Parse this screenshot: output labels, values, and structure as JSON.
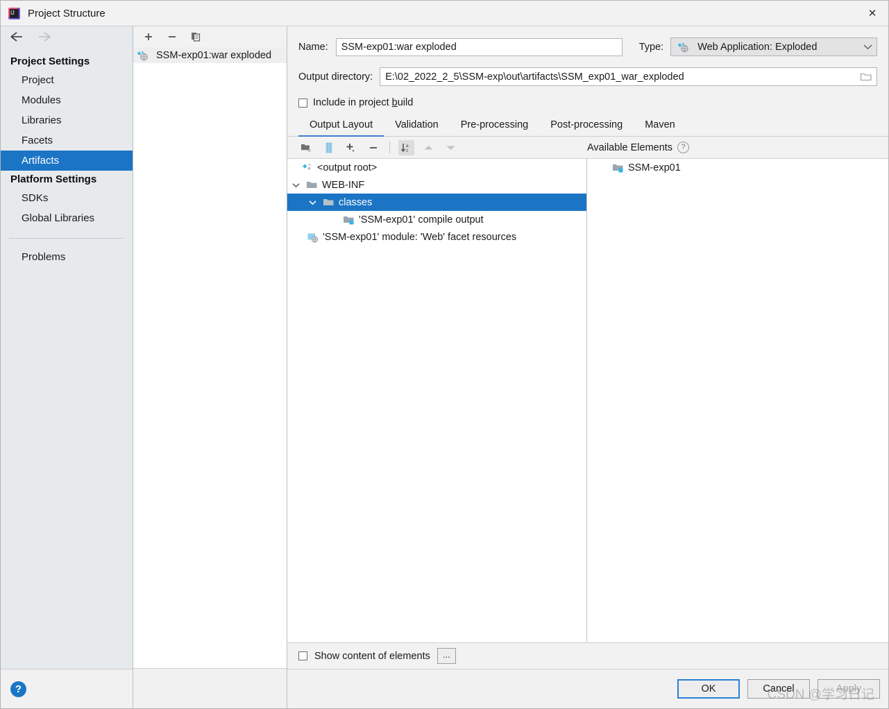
{
  "window": {
    "title": "Project Structure",
    "app_icon": "intellij-idea-icon",
    "close_label": "✕"
  },
  "sidebar": {
    "back_icon": "arrow-left-icon",
    "forward_icon": "arrow-right-icon",
    "groups": [
      {
        "title": "Project Settings",
        "items": [
          {
            "label": "Project",
            "selected": false
          },
          {
            "label": "Modules",
            "selected": false
          },
          {
            "label": "Libraries",
            "selected": false
          },
          {
            "label": "Facets",
            "selected": false
          },
          {
            "label": "Artifacts",
            "selected": true
          }
        ]
      },
      {
        "title": "Platform Settings",
        "items": [
          {
            "label": "SDKs",
            "selected": false
          },
          {
            "label": "Global Libraries",
            "selected": false
          }
        ]
      }
    ],
    "problems": {
      "label": "Problems"
    },
    "help_icon": "help-question-icon",
    "help_label": "?"
  },
  "artifacts_panel": {
    "toolbar": [
      {
        "name": "add-artifact-button",
        "glyph": "+"
      },
      {
        "name": "remove-artifact-button",
        "glyph": "−"
      },
      {
        "name": "copy-artifact-button",
        "glyph": "copy-icon"
      }
    ],
    "items": [
      {
        "label": "SSM-exp01:war exploded",
        "icon": "web-exploded-artifact-icon",
        "selected": true
      }
    ]
  },
  "form": {
    "name_label": "Name:",
    "name_value": "SSM-exp01:war exploded",
    "name_placeholder": "",
    "type_label": "Type:",
    "type_value": "Web Application: Exploded",
    "type_icon": "web-exploded-artifact-icon",
    "output_dir_label": "Output directory:",
    "output_dir_value": "E:\\02_2022_2_5\\SSM-exp\\out\\artifacts\\SSM_exp01_war_exploded",
    "output_dir_placeholder": "",
    "browse_icon": "folder-browse-icon",
    "include_build_label_pre": "Include in project ",
    "include_build_label_accel": "b",
    "include_build_label_post": "uild",
    "include_build_checked": false
  },
  "tabs": [
    {
      "label": "Output Layout",
      "active": true
    },
    {
      "label": "Validation",
      "active": false
    },
    {
      "label": "Pre-processing",
      "active": false
    },
    {
      "label": "Post-processing",
      "active": false
    },
    {
      "label": "Maven",
      "active": false
    }
  ],
  "layout_toolbar": [
    {
      "name": "create-directory-button",
      "icon": "folder-add-icon",
      "state": "enabled"
    },
    {
      "name": "create-archive-button",
      "icon": "archive-jar-icon",
      "state": "enabled"
    },
    {
      "name": "add-copy-of-button",
      "icon": "plus-dropdown-icon",
      "state": "enabled"
    },
    {
      "name": "remove-element-button",
      "icon": "minus-icon",
      "state": "enabled"
    },
    {
      "name": "sort-elements-button",
      "icon": "sort-alpha-icon",
      "state": "pressed"
    },
    {
      "name": "move-up-button",
      "icon": "chevron-up-icon",
      "state": "disabled"
    },
    {
      "name": "move-down-button",
      "icon": "chevron-down-icon",
      "state": "disabled"
    }
  ],
  "available_elements": {
    "header": "Available Elements",
    "help_glyph": "?",
    "items": [
      {
        "label": "SSM-exp01",
        "icon": "module-compile-output-icon",
        "indent": 1
      }
    ]
  },
  "output_tree": [
    {
      "label": "<output root>",
      "icon": "artifact-root-icon",
      "indent": 0,
      "twisty": "none",
      "selected": false
    },
    {
      "label": "WEB-INF",
      "icon": "folder-icon",
      "indent": 0,
      "twisty": "expanded",
      "selected": false
    },
    {
      "label": "classes",
      "icon": "folder-icon",
      "indent": 1,
      "twisty": "expanded",
      "selected": true
    },
    {
      "label": "'SSM-exp01' compile output",
      "icon": "module-compile-output-icon",
      "indent": 2,
      "twisty": "none",
      "selected": false
    },
    {
      "label": "'SSM-exp01' module: 'Web' facet resources",
      "icon": "web-facet-resources-icon",
      "indent": 0,
      "twisty": "none",
      "selected": false
    }
  ],
  "bottom_bar": {
    "show_content_label": "Show content of elements",
    "show_content_checked": false,
    "dots_label": "..."
  },
  "footer": {
    "ok_label": "OK",
    "cancel_label": "Cancel",
    "apply_label": "Apply"
  },
  "watermark": {
    "text": "CSDN @学习日记"
  },
  "colors": {
    "accent": "#1b75c4",
    "tab_underline": "#3a7fd5",
    "sidebar_bg": "#e6eaed",
    "folder": "#9aa7b0",
    "module_blue": "#389fd6"
  }
}
